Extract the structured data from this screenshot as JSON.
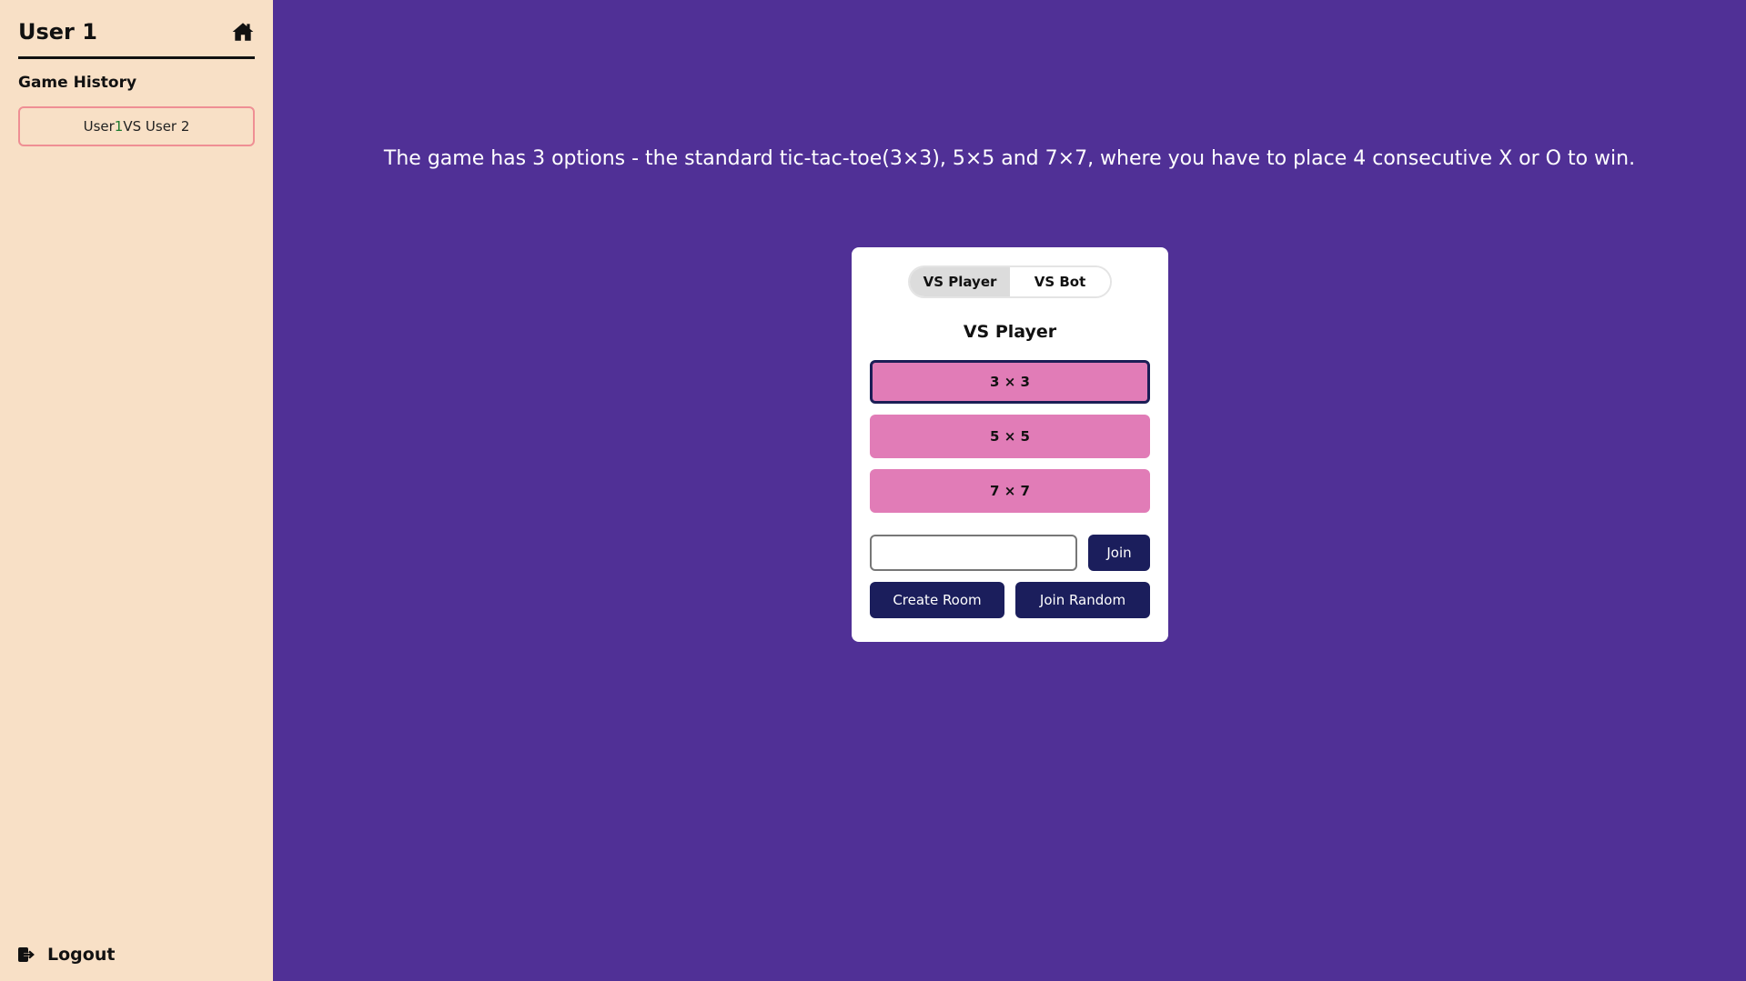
{
  "sidebar": {
    "user_name": "User 1",
    "history_title": "Game History",
    "history_items": [
      {
        "prefix": "User ",
        "num": "1",
        "suffix": " VS User 2"
      }
    ],
    "logout_label": "Logout"
  },
  "main": {
    "description": "The game has 3 options - the standard tic-tac-toe(3×3), 5×5 and 7×7, where you have to place 4 consecutive X or O to win."
  },
  "card": {
    "tabs": [
      "VS Player",
      "VS Bot"
    ],
    "active_tab": "VS Player",
    "mode_title": "VS Player",
    "sizes": [
      "3 × 3",
      "5 × 5",
      "7 × 7"
    ],
    "room_input_value": "",
    "join_label": "Join",
    "create_room_label": "Create Room",
    "join_random_label": "Join Random"
  },
  "colors": {
    "background": "#503096",
    "sidebar": "#f8e0c6",
    "size_button": "#e17cb7",
    "dark_button": "#1b1e5c"
  },
  "icons": {
    "home": "home-icon",
    "logout": "logout-icon"
  }
}
